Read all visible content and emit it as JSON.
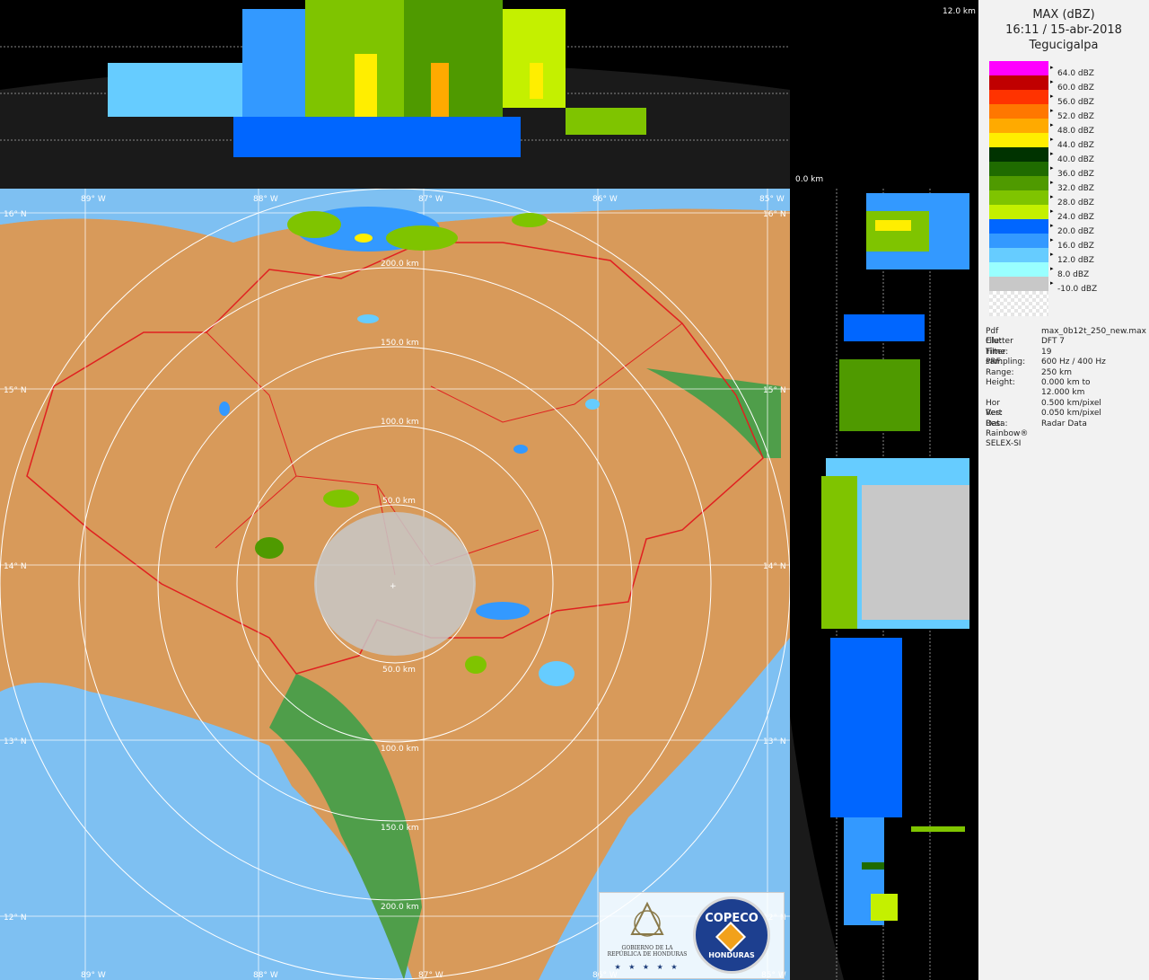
{
  "product": {
    "title": "MAX (dBZ)",
    "datetime": "16:11 / 15-abr-2018",
    "site": "Tegucigalpa"
  },
  "legend": [
    {
      "label": "64.0 dBZ",
      "color": "#ff00ff"
    },
    {
      "label": "60.0 dBZ",
      "color": "#c00000"
    },
    {
      "label": "56.0 dBZ",
      "color": "#ff3300"
    },
    {
      "label": "52.0 dBZ",
      "color": "#ff7700"
    },
    {
      "label": "48.0 dBZ",
      "color": "#ffaa00"
    },
    {
      "label": "44.0 dBZ",
      "color": "#ffee00"
    },
    {
      "label": "40.0 dBZ",
      "color": "#003300"
    },
    {
      "label": "36.0 dBZ",
      "color": "#1f6b00"
    },
    {
      "label": "32.0 dBZ",
      "color": "#4f9a00"
    },
    {
      "label": "28.0 dBZ",
      "color": "#7fc400"
    },
    {
      "label": "24.0 dBZ",
      "color": "#c4f000"
    },
    {
      "label": "20.0 dBZ",
      "color": "#0066ff"
    },
    {
      "label": "16.0 dBZ",
      "color": "#3399ff"
    },
    {
      "label": "12.0 dBZ",
      "color": "#66ccff"
    },
    {
      "label": "8.0 dBZ",
      "color": "#99ffff"
    },
    {
      "label": "-10.0 dBZ",
      "color": "#c8c8c8"
    }
  ],
  "metadata": [
    {
      "key": "Pdf File:",
      "value": "max_0b12t_250_new.max"
    },
    {
      "key": "Clutter Filter:",
      "value": "DFT 7"
    },
    {
      "key": "Time sampling:",
      "value": "19"
    },
    {
      "key": "PRF:",
      "value": "600 Hz / 400 Hz"
    },
    {
      "key": "Range:",
      "value": "250 km"
    },
    {
      "key": "Height:",
      "value": "0.000 km to"
    },
    {
      "key": "",
      "value": "12.000 km"
    },
    {
      "key": "Hor Res:",
      "value": "0.500 km/pixel"
    },
    {
      "key": "Vert Res:",
      "value": "0.050 km/pixel"
    },
    {
      "key": "Data:",
      "value": "Radar Data"
    },
    {
      "key": "Rainbow® SELEX-SI",
      "value": ""
    }
  ],
  "height_labels": {
    "top": "12.0 km",
    "bottom": "0.0 km"
  },
  "longitudes": [
    "89° W",
    "88° W",
    "87° W",
    "86° W",
    "85° W"
  ],
  "latitudes": [
    "16° N",
    "15° N",
    "14° N",
    "13° N",
    "12° N"
  ],
  "range_rings": [
    "50.0 km",
    "100.0 km",
    "150.0 km",
    "200.0 km"
  ],
  "logos": {
    "gov_line1": "GOBIERNO DE LA",
    "gov_line2": "REPÚBLICA DE HONDURAS",
    "copeco_top": "COPECO",
    "copeco_bottom": "HONDURAS",
    "stars": "★ ★ ★ ★ ★"
  },
  "colors": {
    "sea": "#7ec0f2",
    "land_low": "#4f9e4a",
    "land_mid": "#d89a5a",
    "border": "#e02020",
    "ring": "#ffffff"
  }
}
